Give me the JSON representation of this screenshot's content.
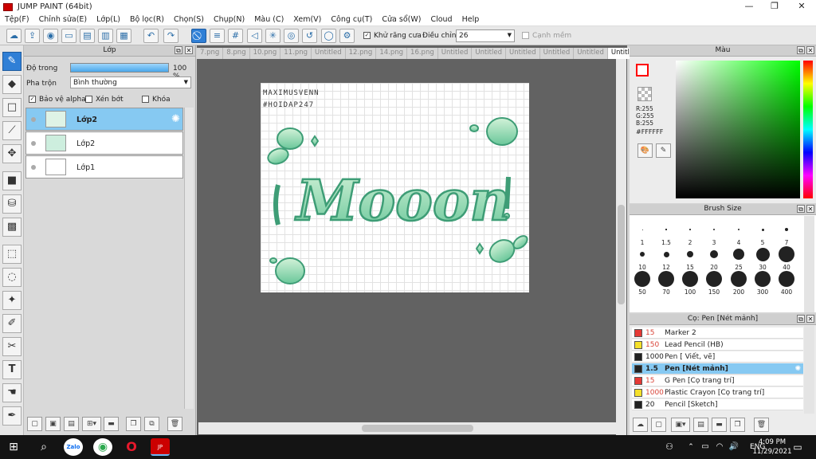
{
  "window": {
    "title": "JUMP PAINT (64bit)",
    "minimize": "—",
    "maximize": "❐",
    "close": "✕"
  },
  "menu": [
    "Tệp(F)",
    "Chỉnh sửa(E)",
    "Lớp(L)",
    "Bộ lọc(R)",
    "Chọn(S)",
    "Chụp(N)",
    "Màu (C)",
    "Xem(V)",
    "Công cụ(T)",
    "Cửa sổ(W)",
    "Cloud",
    "Help"
  ],
  "toolbar": {
    "antialias_label": "Khử răng cưa",
    "adjust_label": "Điều chỉnh",
    "adjust_value": "26",
    "smooth_label": "Cạnh mềm"
  },
  "layer_panel": {
    "title": "Lớp",
    "opacity_label": "Độ trong",
    "opacity_value": "100 %",
    "opacity_percent": 100,
    "blend_label": "Pha trộn",
    "blend_value": "Bình thường",
    "protect_alpha": "Bảo vệ alpha",
    "clip": "Xén bớt",
    "lock": "Khóa",
    "layers": [
      {
        "name": "Lớp2",
        "selected": true
      },
      {
        "name": "Lớp2",
        "selected": false
      },
      {
        "name": "Lớp1",
        "selected": false
      }
    ]
  },
  "tabs": [
    "7.png",
    "8.png",
    "10.png",
    "11.png",
    "Untitled",
    "12.png",
    "14.png",
    "16.png",
    "Untitled",
    "Untitled",
    "Untitled",
    "Untitled",
    "Untitled",
    "Untitled"
  ],
  "active_tab_index": 13,
  "canvas": {
    "watermark_line1": "MAXIMUSVENN",
    "watermark_line2": "#HOIDAP247",
    "artwork_text": "Mooon"
  },
  "color_panel": {
    "title": "Màu",
    "r": "R:255",
    "g": "G:255",
    "b": "B:255",
    "hex": "#FFFFFF",
    "main_color": "#ff0000"
  },
  "brush_panel": {
    "title": "Brush Size",
    "sizes": [
      "1",
      "1.5",
      "2",
      "3",
      "4",
      "5",
      "7",
      "10",
      "12",
      "15",
      "20",
      "25",
      "30",
      "40",
      "50",
      "70",
      "100",
      "150",
      "200",
      "300",
      "400"
    ]
  },
  "pen_panel": {
    "title": "Cọ: Pen [Nét mảnh]",
    "pens": [
      {
        "size": "15",
        "name": "Marker 2",
        "color": "#e53935",
        "selected": false
      },
      {
        "size": "150",
        "name": "Lead Pencil (HB)",
        "color": "#f5e02a",
        "selected": false
      },
      {
        "size": "1000",
        "name": "Pen [ Viết, vẽ]",
        "color": "#222222",
        "selected": false
      },
      {
        "size": "1.5",
        "name": "Pen [Nét mảnh]",
        "color": "#222222",
        "selected": true
      },
      {
        "size": "15",
        "name": "G Pen [Cọ trang trí]",
        "color": "#e53935",
        "selected": false
      },
      {
        "size": "1000",
        "name": "Plastic Crayon [Cọ trang trí]",
        "color": "#f5e02a",
        "selected": false
      },
      {
        "size": "20",
        "name": "Pencil [Sketch]",
        "color": "#222222",
        "selected": false
      }
    ]
  },
  "taskbar": {
    "time": "4:09 PM",
    "date": "11/29/2021",
    "lang": "ENG",
    "zalo": "Zalo"
  }
}
